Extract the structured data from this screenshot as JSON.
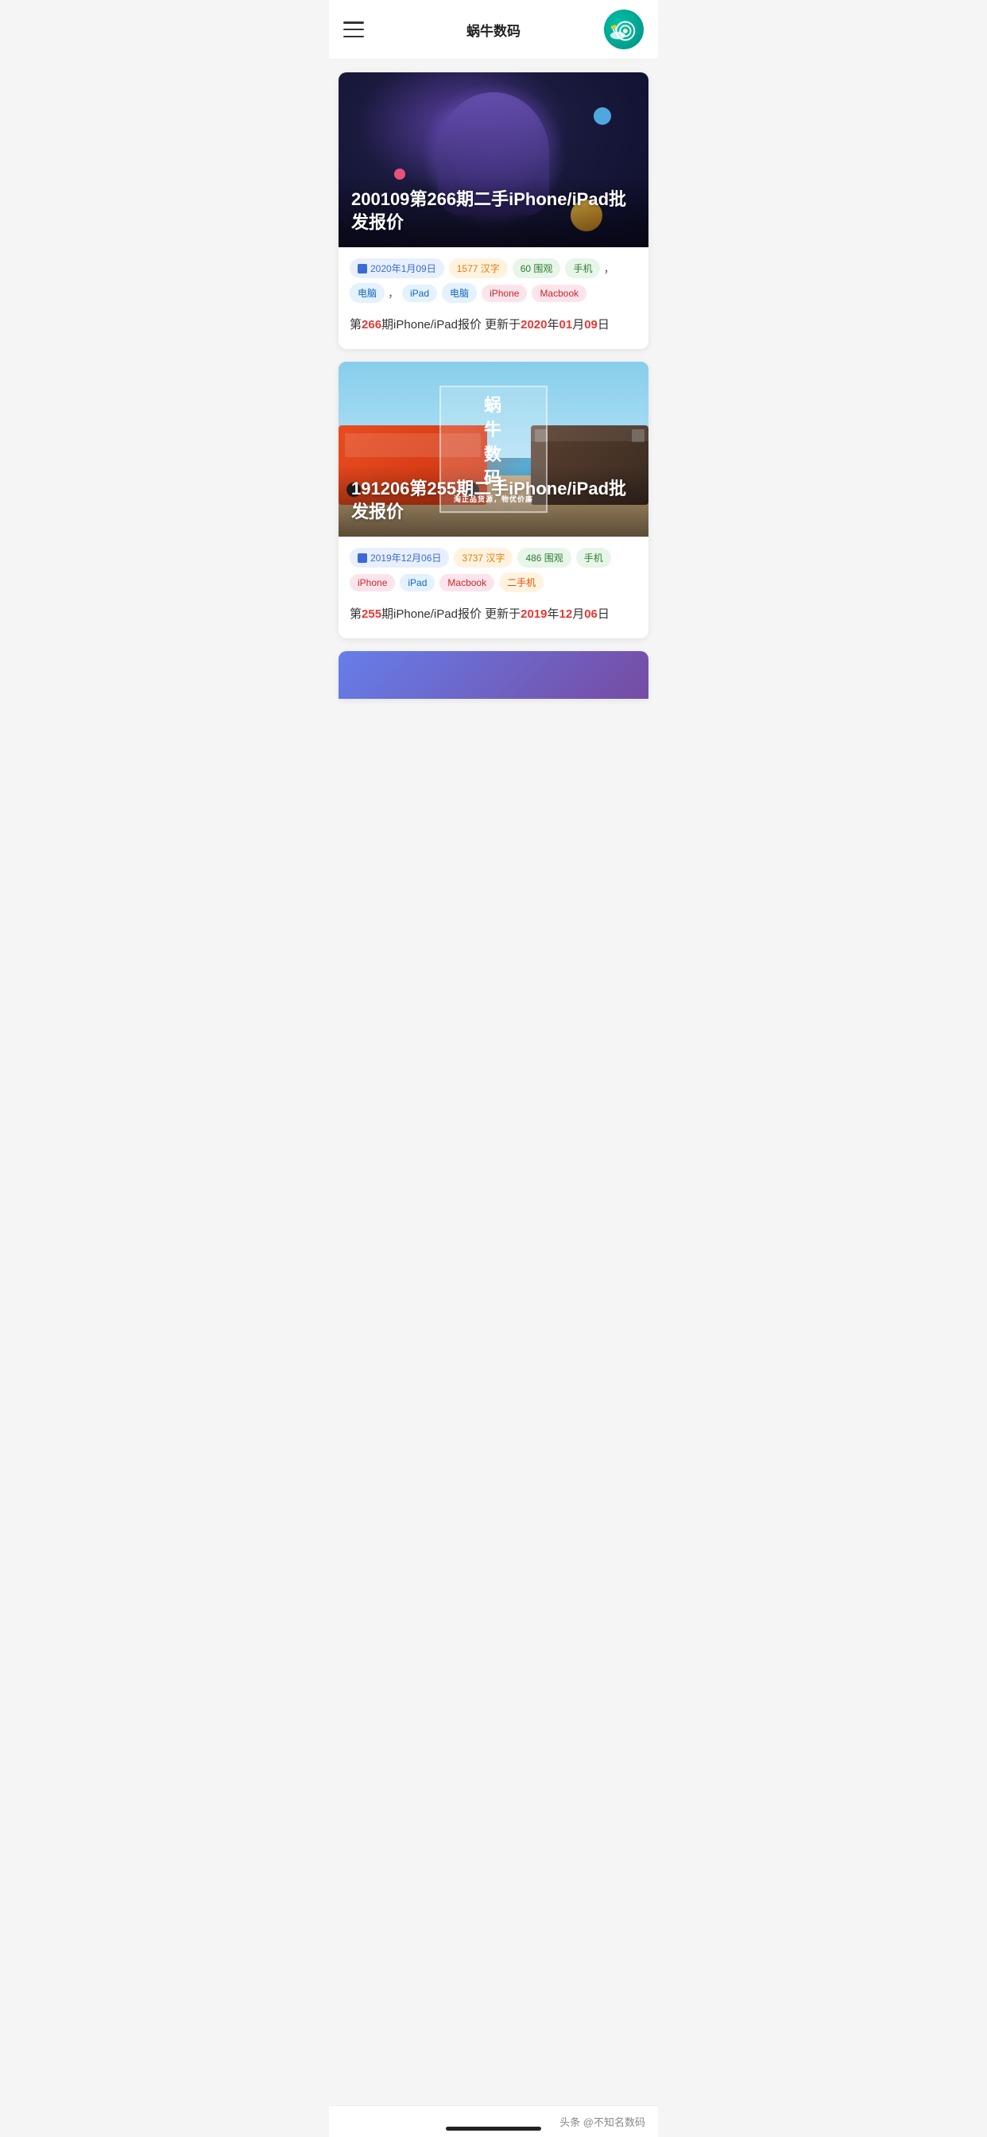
{
  "header": {
    "title": "蜗牛数码",
    "logo_alt": "snail-logo"
  },
  "articles": [
    {
      "id": "article-1",
      "title": "200109第266期二手iPhone/iPad批发报价",
      "image_type": "purple_tech",
      "date_label": "2020年1月09日",
      "words_label": "1577 汉字",
      "views_label": "60 围观",
      "tags": [
        "手机",
        "电脑",
        "iPad",
        "电脑",
        "iPhone",
        "Macbook"
      ],
      "description_template": "第{266}期iPhone/iPad报价 更新于{2020}年{01}月{09}日",
      "desc_plain": "第",
      "desc_num1": "266",
      "desc_mid1": "期iPhone/iPad报价 更新于",
      "desc_num2": "2020",
      "desc_mid2": "年",
      "desc_num3": "01",
      "desc_mid3": "月",
      "desc_num4": "09",
      "desc_end": "日"
    },
    {
      "id": "article-2",
      "title": "191206第255期二手iPhone/iPad批发报价",
      "image_type": "train_station",
      "date_label": "2019年12月06日",
      "words_label": "3737 汉字",
      "views_label": "486 围观",
      "tags": [
        "手机",
        "iPhone",
        "iPad",
        "Macbook",
        "二手机"
      ],
      "description_template": "第{255}期iPhone/iPad报价 更新于{2019}年{12}月{06}日",
      "desc_plain": "第",
      "desc_num1": "255",
      "desc_mid1": "期iPhone/iPad报价 更新于",
      "desc_num2": "2019",
      "desc_mid2": "年",
      "desc_num3": "12",
      "desc_mid3": "月",
      "desc_num4": "06",
      "desc_end": "日"
    }
  ],
  "watermark": {
    "line1": "蜗",
    "line2": "牛",
    "line3": "数",
    "line4": "码",
    "subtitle": "淘正品货源，物优价廉"
  },
  "bottom_bar": {
    "label": "头条 @不知名数码"
  }
}
